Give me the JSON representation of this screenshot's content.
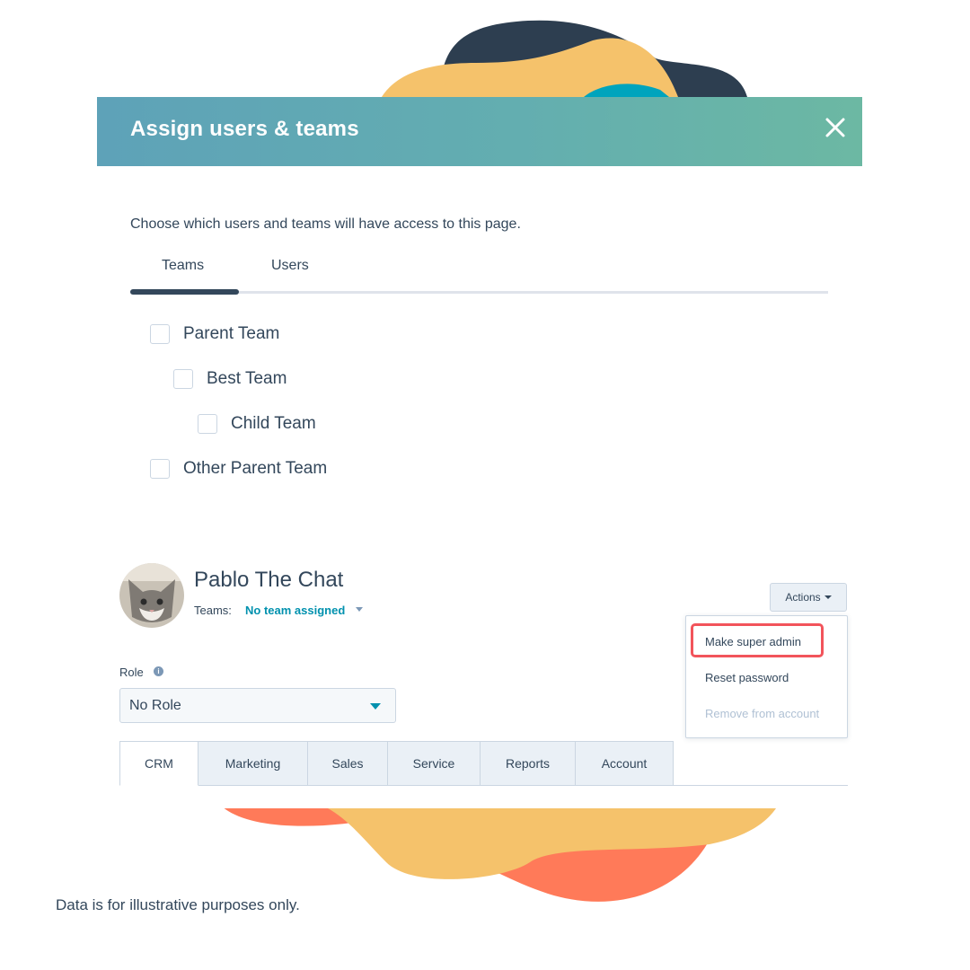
{
  "modal": {
    "title": "Assign users & teams",
    "close_icon": "close-icon",
    "instruction": "Choose which users and teams will have access to this page.",
    "tabs": [
      {
        "label": "Teams",
        "active": true
      },
      {
        "label": "Users",
        "active": false
      }
    ],
    "teams": [
      {
        "label": "Parent Team",
        "checked": false,
        "level": 0
      },
      {
        "label": "Best Team",
        "checked": false,
        "level": 1
      },
      {
        "label": "Child Team",
        "checked": false,
        "level": 2
      },
      {
        "label": "Other Parent Team",
        "checked": false,
        "level": 0
      }
    ]
  },
  "user": {
    "name": "Pablo The Chat",
    "teams_label": "Teams:",
    "teams_value": "No team assigned",
    "actions_label": "Actions",
    "actions_menu": [
      {
        "label": "Make super admin",
        "highlighted": true,
        "disabled": false
      },
      {
        "label": "Reset password",
        "highlighted": false,
        "disabled": false
      },
      {
        "label": "Remove from account",
        "highlighted": false,
        "disabled": true
      }
    ],
    "role_label": "Role",
    "role_value": "No Role",
    "permission_tabs": [
      {
        "label": "CRM",
        "active": true
      },
      {
        "label": "Marketing",
        "active": false
      },
      {
        "label": "Sales",
        "active": false
      },
      {
        "label": "Service",
        "active": false
      },
      {
        "label": "Reports",
        "active": false
      },
      {
        "label": "Account",
        "active": false
      }
    ]
  },
  "disclaimer": "Data is for illustrative purposes only.",
  "colors": {
    "header_gradient_start": "#5ea2b8",
    "header_gradient_end": "#6cb8a3",
    "text": "#33475b",
    "link": "#0091ae",
    "highlight": "#f2545b",
    "blob_navy": "#2d3e50",
    "blob_yellow": "#f5c26b",
    "blob_teal": "#00a4bd",
    "blob_coral": "#ff7a59"
  }
}
